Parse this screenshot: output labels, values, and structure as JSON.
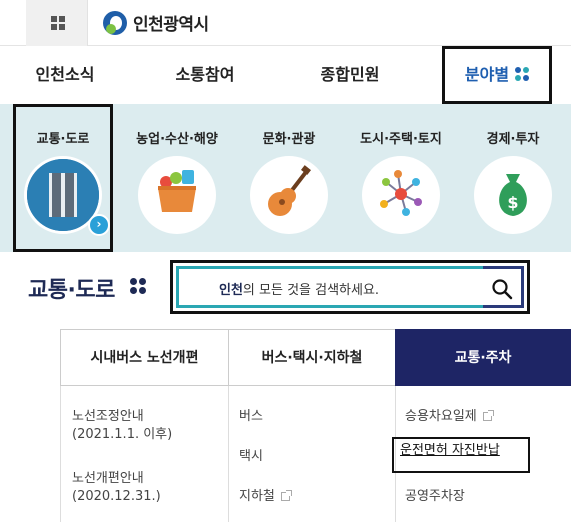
{
  "header": {
    "logo_text": "인천광역시"
  },
  "mainnav": {
    "items": [
      {
        "label": "인천소식"
      },
      {
        "label": "소통참여"
      },
      {
        "label": "종합민원"
      },
      {
        "label": "분야별"
      }
    ],
    "accent": "#1f5fb0"
  },
  "categories": [
    {
      "label": "교통·도로",
      "icon": "road-icon"
    },
    {
      "label": "농업·수산·해양",
      "icon": "basket-icon"
    },
    {
      "label": "문화·관광",
      "icon": "guitar-icon"
    },
    {
      "label": "도시·주택·토지",
      "icon": "network-icon"
    },
    {
      "label": "경제·투자",
      "icon": "money-bag-icon"
    }
  ],
  "page": {
    "title": "교통·도로"
  },
  "search": {
    "highlight": "인천",
    "rest": "의 모든 것을 검색하세요."
  },
  "tabs": [
    {
      "label": "시내버스 노선개편"
    },
    {
      "label": "버스·택시·지하철"
    },
    {
      "label": "교통·주차"
    }
  ],
  "lists": {
    "col0": [
      "노선조정안내",
      "(2021.1.1. 이후)",
      "노선개편안내",
      "(2020.12.31.)"
    ],
    "col1": [
      "버스",
      "택시",
      "지하철"
    ],
    "col2": [
      "승용차요일제",
      "운전면허 자진반납",
      "공영주차장"
    ]
  }
}
